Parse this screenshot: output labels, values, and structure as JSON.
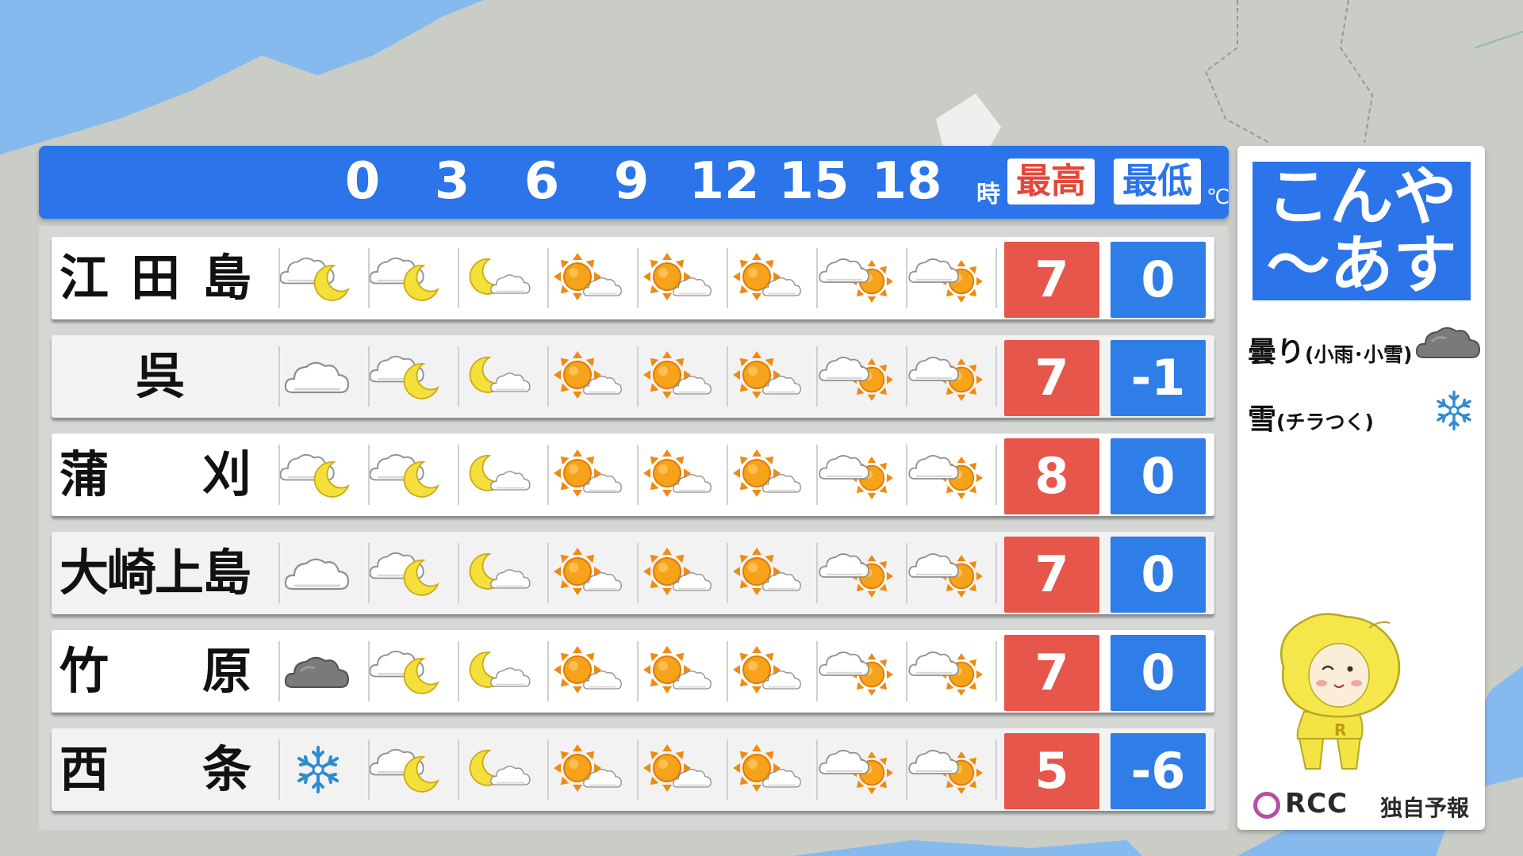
{
  "header": {
    "hours": [
      "0",
      "3",
      "6",
      "9",
      "12",
      "15",
      "18"
    ],
    "hour_suffix": "時",
    "max_label": "最高",
    "min_label": "最低",
    "unit": "℃"
  },
  "rows": [
    {
      "name": "江田島",
      "icons": [
        "cloud-moon",
        "cloud-moon",
        "moon-cloud",
        "sun-cloud",
        "sun-cloud",
        "sun-cloud",
        "cloud-sun",
        "cloud-sun"
      ],
      "max": "7",
      "min": "0"
    },
    {
      "name": "呉",
      "icons": [
        "cloud",
        "cloud-moon",
        "moon-cloud",
        "sun-cloud",
        "sun-cloud",
        "sun-cloud",
        "cloud-sun",
        "cloud-sun"
      ],
      "max": "7",
      "min": "-1"
    },
    {
      "name": "蒲刈",
      "icons": [
        "cloud-moon",
        "cloud-moon",
        "moon-cloud",
        "sun-cloud",
        "sun-cloud",
        "sun-cloud",
        "cloud-sun",
        "cloud-sun"
      ],
      "max": "8",
      "min": "0"
    },
    {
      "name": "大崎上島",
      "icons": [
        "cloud",
        "cloud-moon",
        "moon-cloud",
        "sun-cloud",
        "sun-cloud",
        "sun-cloud",
        "cloud-sun",
        "cloud-sun"
      ],
      "max": "7",
      "min": "0"
    },
    {
      "name": "竹原",
      "icons": [
        "dark-cloud",
        "cloud-moon",
        "moon-cloud",
        "sun-cloud",
        "sun-cloud",
        "sun-cloud",
        "cloud-sun",
        "cloud-sun"
      ],
      "max": "7",
      "min": "0"
    },
    {
      "name": "西条",
      "icons": [
        "snow",
        "cloud-moon",
        "moon-cloud",
        "sun-cloud",
        "sun-cloud",
        "sun-cloud",
        "cloud-sun",
        "cloud-sun"
      ],
      "max": "5",
      "min": "-6"
    }
  ],
  "side": {
    "period": "こんや\n〜あす",
    "legend": [
      {
        "main": "曇り",
        "sub": "(小雨･小雪)",
        "icon": "dark-cloud"
      },
      {
        "main": "雪",
        "sub": "(チラつく)",
        "icon": "snow"
      }
    ],
    "logo_mark": "RCC",
    "logo_text": "独自予報"
  },
  "colors": {
    "header_blue": "#2b74ea",
    "max_red": "#e6564a",
    "min_blue": "#2f7de6",
    "sea": "#86b9ee",
    "land": "#c9cdc5"
  }
}
